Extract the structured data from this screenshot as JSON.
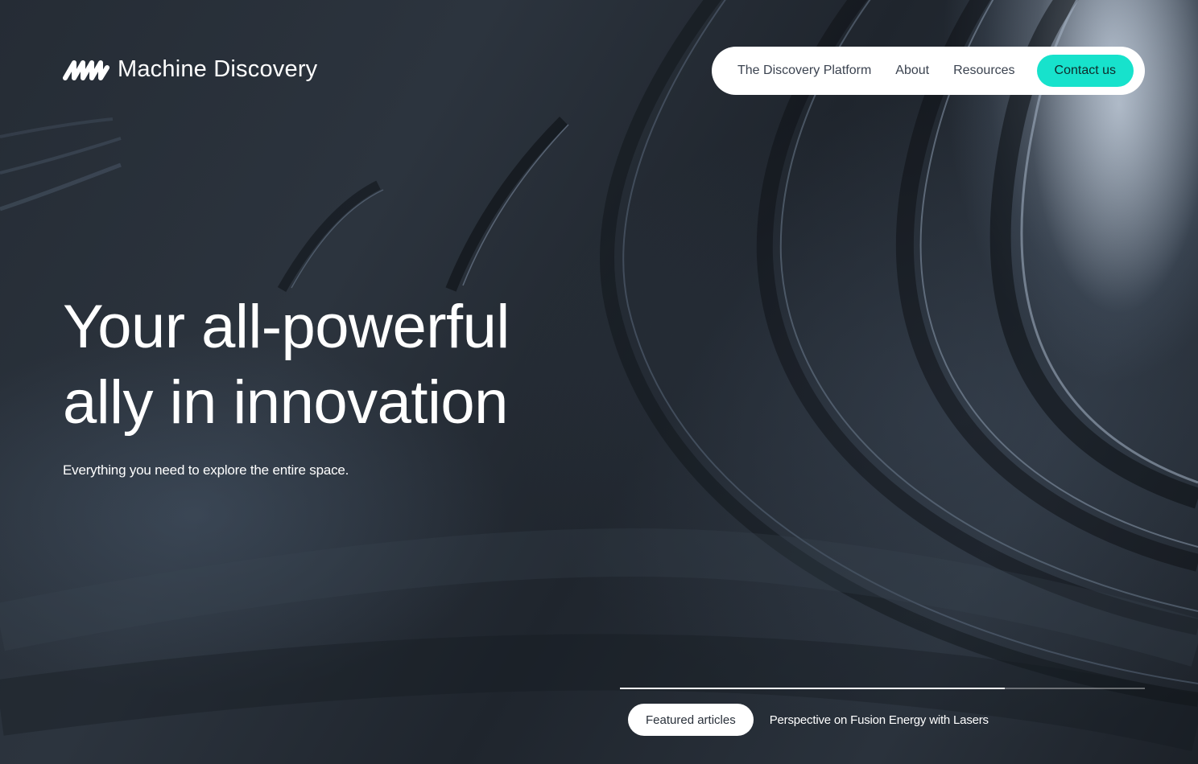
{
  "brand": {
    "name": "Machine Discovery",
    "logo_icon": "machine-discovery-logo-mark"
  },
  "nav": {
    "links": [
      {
        "label": "The Discovery Platform"
      },
      {
        "label": "About"
      },
      {
        "label": "Resources"
      }
    ],
    "cta_label": "Contact us",
    "cta_color": "#17e2cc"
  },
  "hero": {
    "headline_line1": "Your all-powerful",
    "headline_line2": "ally in innovation",
    "subheadline": "Everything you need to explore the entire space."
  },
  "featured": {
    "pill_label": "Featured articles",
    "article_title": "Perspective on Fusion Energy with Lasers",
    "slide_progress": 0.733
  }
}
